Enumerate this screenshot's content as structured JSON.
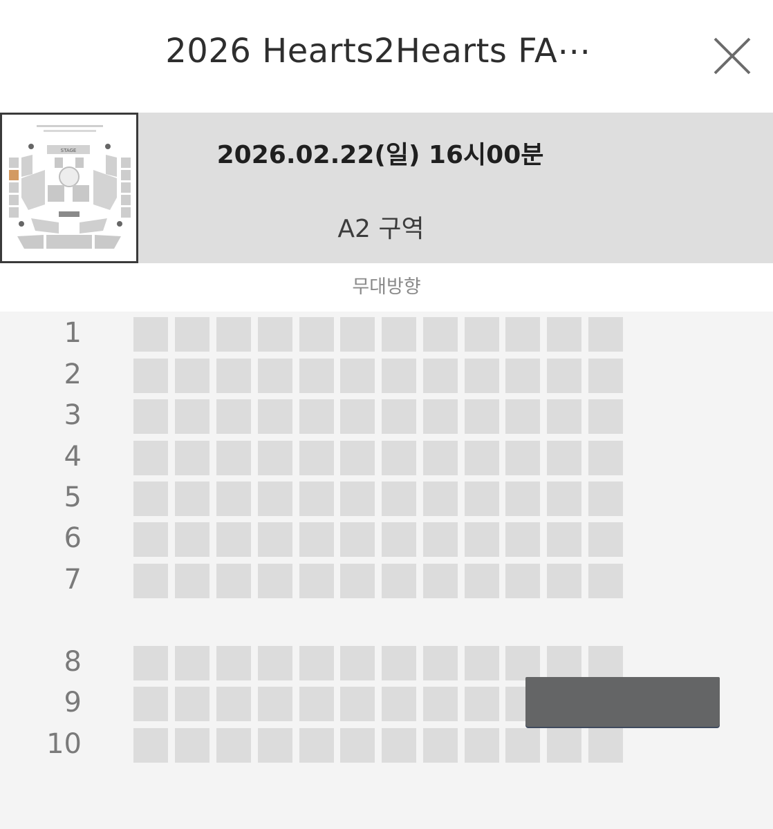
{
  "header": {
    "title": "2026 Hearts2Hearts FA⋯",
    "close_icon": "close-icon"
  },
  "performance": {
    "date_time": "2026.02.22(일) 16시00분",
    "zone": "A2 구역",
    "selected_zone_color": "#d39a62"
  },
  "minimap": {
    "stage_label": "STAGE"
  },
  "seat_map": {
    "stage_direction": "무대방향",
    "rows": [
      "1",
      "2",
      "3",
      "4",
      "5",
      "6",
      "7",
      "8",
      "9",
      "10"
    ],
    "seats_per_row": 12,
    "seat_color": "#dcdcdc"
  },
  "colors": {
    "background": "#f4f4f4",
    "info_bar": "#dedede",
    "overlay": "#646566"
  }
}
